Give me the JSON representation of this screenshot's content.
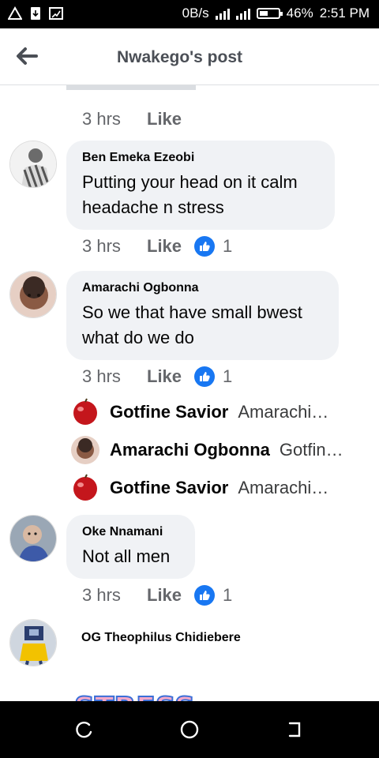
{
  "status_bar": {
    "left_icons": [
      "warning-icon",
      "file-download-icon",
      "screen-cast-icon"
    ],
    "network_speed": "0B/s",
    "battery_percent": "46%",
    "battery_level": 0.46,
    "time": "2:51 PM"
  },
  "header": {
    "title": "Nwakego's post",
    "back_icon": "back-arrow-icon"
  },
  "colors": {
    "like_badge": "#1877f2",
    "bubble": "#f0f2f5",
    "meta_text": "#65676b"
  },
  "top_meta": {
    "time": "3 hrs",
    "like": "Like"
  },
  "comments": [
    {
      "name": "Ben Emeka Ezeobi",
      "text": "Putting your head on it calm headache n stress",
      "time": "3 hrs",
      "like": "Like",
      "reactions": "1"
    },
    {
      "name": "Amarachi Ogbonna",
      "text": "So we that have small bwest what do we do",
      "time": "3 hrs",
      "like": "Like",
      "reactions": "1",
      "replies": [
        {
          "name": "Gotfine Savior",
          "preview": "Amarachi…"
        },
        {
          "name": "Amarachi Ogbonna",
          "preview": "Gotfin…"
        },
        {
          "name": "Gotfine Savior",
          "preview": "Amarachi…"
        }
      ]
    },
    {
      "name": "Oke Nnamani",
      "text": "Not all men",
      "time": "3 hrs",
      "like": "Like",
      "reactions": "1"
    },
    {
      "name": "OG Theophilus Chidiebere",
      "sticker_text": "STRESS"
    }
  ],
  "nav_bar": {
    "icons": [
      "recent-apps-icon",
      "home-icon",
      "back-icon"
    ]
  }
}
